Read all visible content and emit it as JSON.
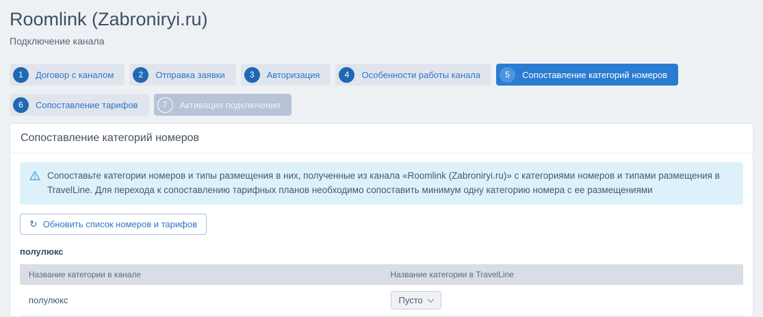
{
  "page": {
    "title": "Roomlink (Zabroniryi.ru)",
    "subtitle": "Подключение канала"
  },
  "steps": [
    {
      "number": "1",
      "label": "Договор с каналом",
      "state": "default"
    },
    {
      "number": "2",
      "label": "Отправка заявки",
      "state": "default"
    },
    {
      "number": "3",
      "label": "Авторизация",
      "state": "default"
    },
    {
      "number": "4",
      "label": "Особенности работы канала",
      "state": "default"
    },
    {
      "number": "5",
      "label": "Сопоставление категорий номеров",
      "state": "active"
    },
    {
      "number": "6",
      "label": "Сопоставление тарифов",
      "state": "default"
    },
    {
      "number": "7",
      "label": "Активация подключения",
      "state": "disabled"
    }
  ],
  "panel": {
    "title": "Сопоставление категорий номеров",
    "alert_text": "Сопоставьте категории номеров и типы размещения в них, полученные из канала «Roomlink (Zabroniryi.ru)» с категориями номеров и типами размещения в TravelLine. Для перехода к сопоставлению тарифных планов необходимо сопоставить минимум одну категорию номера с ее размещениями",
    "refresh_button_label": "Обновить список номеров и тарифов",
    "refresh_icon_glyph": "↻",
    "group_title": "полулюкс",
    "table": {
      "headers": [
        "Название категории в канале",
        "Название категории в TravelLine"
      ],
      "rows": [
        {
          "channel_category": "полулюкс",
          "travelline_category": "Пусто"
        }
      ]
    }
  },
  "icons": {
    "alert": "warning-triangle-icon",
    "refresh": "refresh-icon",
    "dropdown": "chevron-down-icon"
  },
  "colors": {
    "page_background": "#eef1f4",
    "step_active_background": "#2a7cd2",
    "step_default_background": "#e0e5ed",
    "step_disabled_background": "#b7c3d7",
    "step_circle": "#1f68b3",
    "link_blue": "#2e76c6",
    "alert_background": "#def1fb",
    "table_header_background": "#d8dde6"
  }
}
